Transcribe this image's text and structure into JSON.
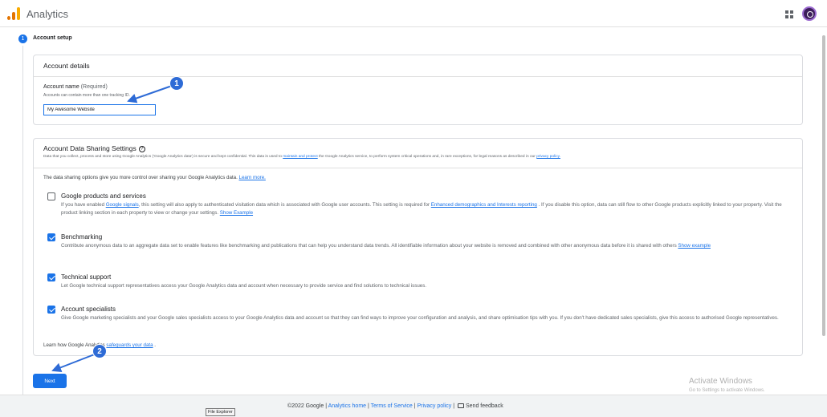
{
  "header": {
    "app_title": "Analytics"
  },
  "stepper": {
    "step_number": "1",
    "step_label": "Account setup"
  },
  "account_details": {
    "title": "Account details",
    "name_label": "Account name",
    "name_required": "(Required)",
    "name_hint": "Accounts can contain more than one tracking ID.",
    "name_value": "My Awesome Website"
  },
  "sharing": {
    "title": "Account Data Sharing Settings",
    "desc_part1": "Data that you collect, process and store using Google Analytics ('Google Analytics data') is secure and kept confidential. This data is used to ",
    "desc_link1": "maintain and protect",
    "desc_part2": " the Google Analytics service, to perform system critical operations and, in rare exceptions, for legal reasons as described in our ",
    "desc_link2": "privacy policy.",
    "intro_text": "The data sharing options give you more control over sharing your Google Analytics data. ",
    "intro_link": "Learn more.",
    "options": [
      {
        "title": "Google products and services",
        "checked": false,
        "desc_a": "If you have enabled ",
        "link_a": "Google signals",
        "desc_b": ", this setting will also apply to authenticated visitation data which is associated with Google user accounts. This setting is required for ",
        "link_b": "Enhanced demographics and Interests reporting",
        "desc_c": " . If you disable this option, data can still flow to other Google products explicitly linked to your property. Visit the product linking section in each property to view or change your settings. ",
        "link_c": "Show Example"
      },
      {
        "title": "Benchmarking",
        "checked": true,
        "desc_a": "Contribute anonymous data to an aggregate data set to enable features like benchmarking and publications that can help you understand data trends. All identifiable information about your website is removed and combined with other anonymous data before it is shared with others ",
        "link_a": "Show example"
      },
      {
        "title": "Technical support",
        "checked": true,
        "desc_a": "Let Google technical support representatives access your Google Analytics data and account when necessary to provide service and find solutions to technical issues."
      },
      {
        "title": "Account specialists",
        "checked": true,
        "desc_a": "Give Google marketing specialists and your Google sales specialists access to your Google Analytics data and account so that they can find ways to improve your configuration and analysis, and share optimisation tips with you. If you don't have dedicated sales specialists, give this access to authorised Google representatives."
      }
    ],
    "learn_text": "Learn how Google Analytics ",
    "learn_link": "safeguards your data",
    "learn_end": " ."
  },
  "next_label": "Next",
  "watermark": {
    "line1": "Activate Windows",
    "line2": "Go to Settings to activate Windows."
  },
  "footer": {
    "copyright": "©2022 Google",
    "sep": " | ",
    "analytics_home": "Analytics home",
    "terms": "Terms of Service",
    "privacy": "Privacy policy",
    "feedback": "Send feedback"
  },
  "tooltip": "File Explorer",
  "annotations": {
    "marker1": "1",
    "marker2": "2"
  },
  "colors": {
    "accent": "#1a73e8",
    "marker": "#2e6bd6",
    "logo_orange": "#f9ab00"
  },
  "icons": [
    "analytics-logo-icon",
    "apps-grid-icon",
    "help-circle-icon",
    "checkbox-checked-icon",
    "feedback-icon"
  ]
}
